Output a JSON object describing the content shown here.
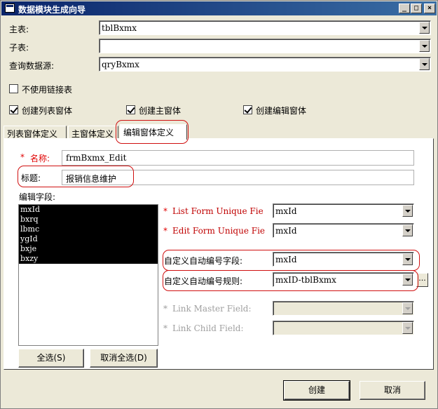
{
  "window": {
    "title": "数据模块生成向导",
    "controls": [
      "_",
      "□",
      "×"
    ]
  },
  "form": {
    "main_table_label": "主表:",
    "main_table_value": "tblBxmx",
    "sub_table_label": "子表:",
    "sub_table_value": "",
    "query_source_label": "查询数据源:",
    "query_source_value": "qryBxmx",
    "no_link_table_label": "不使用链接表",
    "no_link_table_checked": false,
    "create_list_label": "创建列表窗体",
    "create_list_checked": true,
    "create_main_label": "创建主窗体",
    "create_main_checked": true,
    "create_edit_label": "创建编辑窗体",
    "create_edit_checked": true
  },
  "tabs": [
    {
      "label": "列表窗体定义"
    },
    {
      "label": "主窗体定义"
    },
    {
      "label": "编辑窗体定义",
      "active": true
    }
  ],
  "edit_tab": {
    "name_star": "*",
    "name_label": "名称:",
    "name_value": "frmBxmx_Edit",
    "caption_label": "标题:",
    "caption_value": "报销信息维护",
    "fields_label": "编辑字段:",
    "fields": [
      "mxId",
      "bxrq",
      "lbmc",
      "ygId",
      "bxje",
      "bxzy"
    ],
    "select_all_label": "全选(S)",
    "deselect_all_label": "取消全选(D)",
    "list_unique_star": "*",
    "list_unique_label": "List Form Unique Fie",
    "list_unique_value": "mxId",
    "edit_unique_star": "*",
    "edit_unique_label": "Edit Form Unique Fie",
    "edit_unique_value": "mxId",
    "auto_field_label": "自定义自动编号字段:",
    "auto_field_value": "mxId",
    "auto_rule_label": "自定义自动编号规则:",
    "auto_rule_value": "mxID-tblBxmx",
    "ellipsis": "...",
    "link_master_star": "*",
    "link_master_label": "Link Master Field:",
    "link_master_value": "",
    "link_child_star": "*",
    "link_child_label": "Link Child Field:",
    "link_child_value": ""
  },
  "footer": {
    "create_label": "创建",
    "cancel_label": "取消"
  },
  "colors": {
    "titlebar": "#0a246a",
    "annotation": "#d01010",
    "required": "#e00000",
    "selection": "#000000"
  }
}
